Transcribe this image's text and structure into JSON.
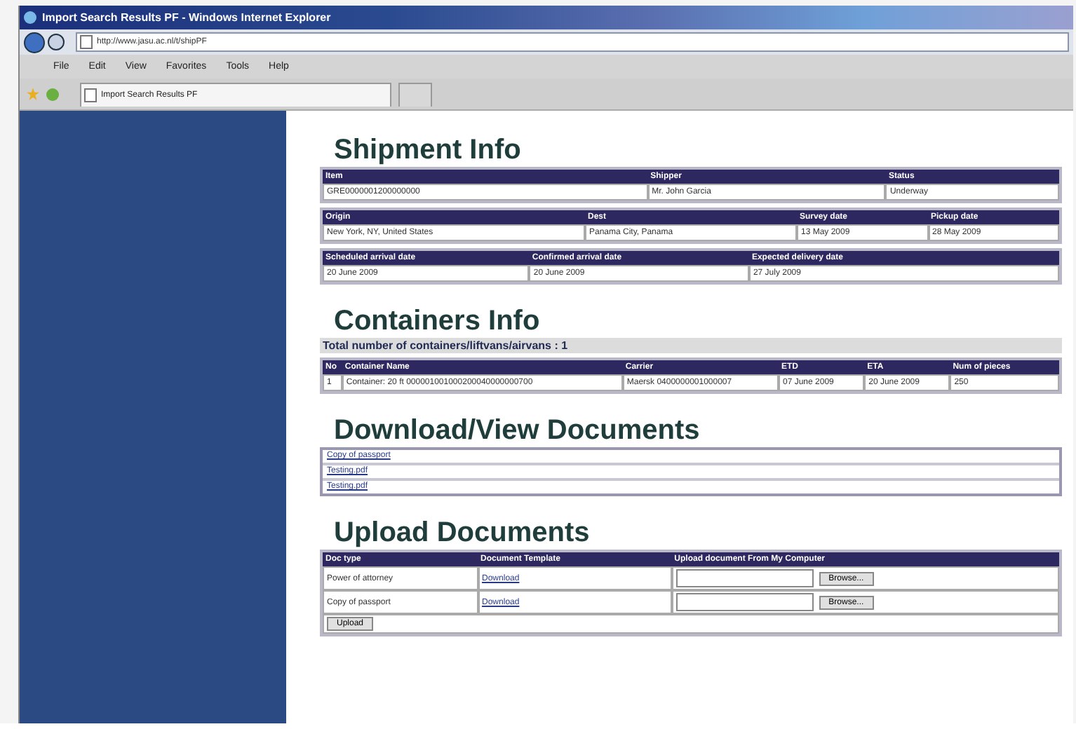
{
  "window": {
    "title": "Import Search Results PF - Windows Internet Explorer"
  },
  "address_bar": {
    "value": "http://www.jasu.ac.nl/t/shipPF"
  },
  "menu": [
    "File",
    "Edit",
    "View",
    "Favorites",
    "Tools",
    "Help"
  ],
  "tab": {
    "label": "Import Search Results PF"
  },
  "sections": [
    {
      "kind": "info",
      "title": "Shipment Info",
      "tables": [
        {
          "columns": [
            "Item",
            "Shipper",
            "Status"
          ],
          "cells": [
            "GRE0000001200000000",
            "Mr. John Garcia",
            "Underway"
          ]
        },
        {
          "columns": [
            "Origin",
            "Dest",
            "Survey date",
            "Pickup date"
          ],
          "cells": [
            "New York, NY, United States",
            "Panama City, Panama",
            "13 May 2009",
            "28 May 2009"
          ]
        },
        {
          "columns": [
            "Scheduled arrival date",
            "Confirmed arrival date",
            "Expected delivery date"
          ],
          "cells": [
            "20 June 2009",
            "20 June 2009",
            "27 July 2009"
          ]
        }
      ]
    },
    {
      "kind": "containers",
      "title": "Containers Info",
      "total": "Total number of containers/liftvans/airvans : 1",
      "columns": [
        "No",
        "Container Name",
        "Carrier",
        "ETD",
        "ETA",
        "Num of pieces"
      ],
      "rows": [
        [
          "1",
          "Container: 20 ft 000001001000200040000000700",
          "Maersk 0400000001000007",
          " 07 June 2009",
          "20 June 2009",
          "250"
        ]
      ]
    },
    {
      "kind": "downloads",
      "title": "Download/View Documents",
      "links": [
        "Copy of passport",
        "Testing.pdf",
        "Testing.pdf"
      ]
    },
    {
      "kind": "upload",
      "title": "Upload Documents",
      "columns": [
        "Doc type",
        "Document Template",
        "Upload document From My Computer"
      ],
      "rows": [
        {
          "doc_type": "Power of attorney",
          "template": "Download",
          "browse": "Browse..."
        },
        {
          "doc_type": "Copy of passport",
          "template": "Download",
          "browse": "Browse..."
        }
      ],
      "submit": "Upload"
    }
  ]
}
